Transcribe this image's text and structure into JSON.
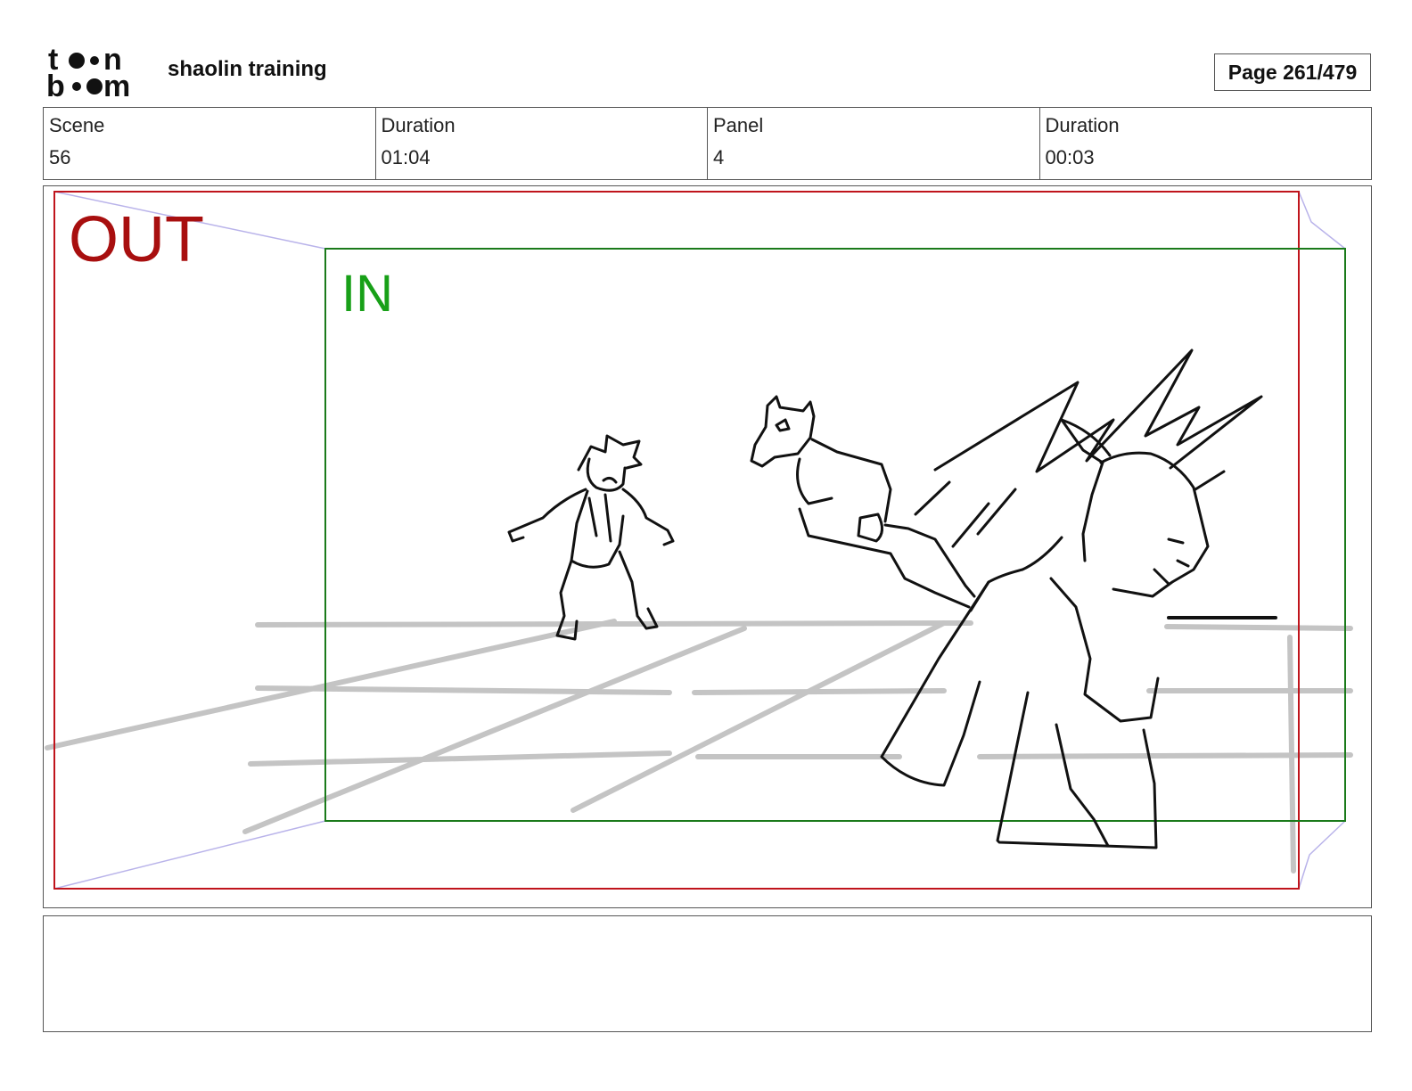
{
  "logo": {
    "line1": "toon",
    "line2": "boom",
    "icon": "toon-boom-logo"
  },
  "project": {
    "title": "shaolin training"
  },
  "page": {
    "label": "Page 261/479"
  },
  "info": [
    {
      "label": "Scene",
      "value": "56"
    },
    {
      "label": "Duration",
      "value": "01:04"
    },
    {
      "label": "Panel",
      "value": "4"
    },
    {
      "label": "Duration",
      "value": "00:03"
    }
  ],
  "panel": {
    "out_label": "OUT",
    "in_label": "IN",
    "colors": {
      "out_frame": "#c0141c",
      "in_frame": "#1a7a1a",
      "camera_path": "#b9b3ea",
      "floor_lines": "#c4c4c4",
      "ink": "#111111"
    }
  },
  "notes": {
    "text": ""
  }
}
